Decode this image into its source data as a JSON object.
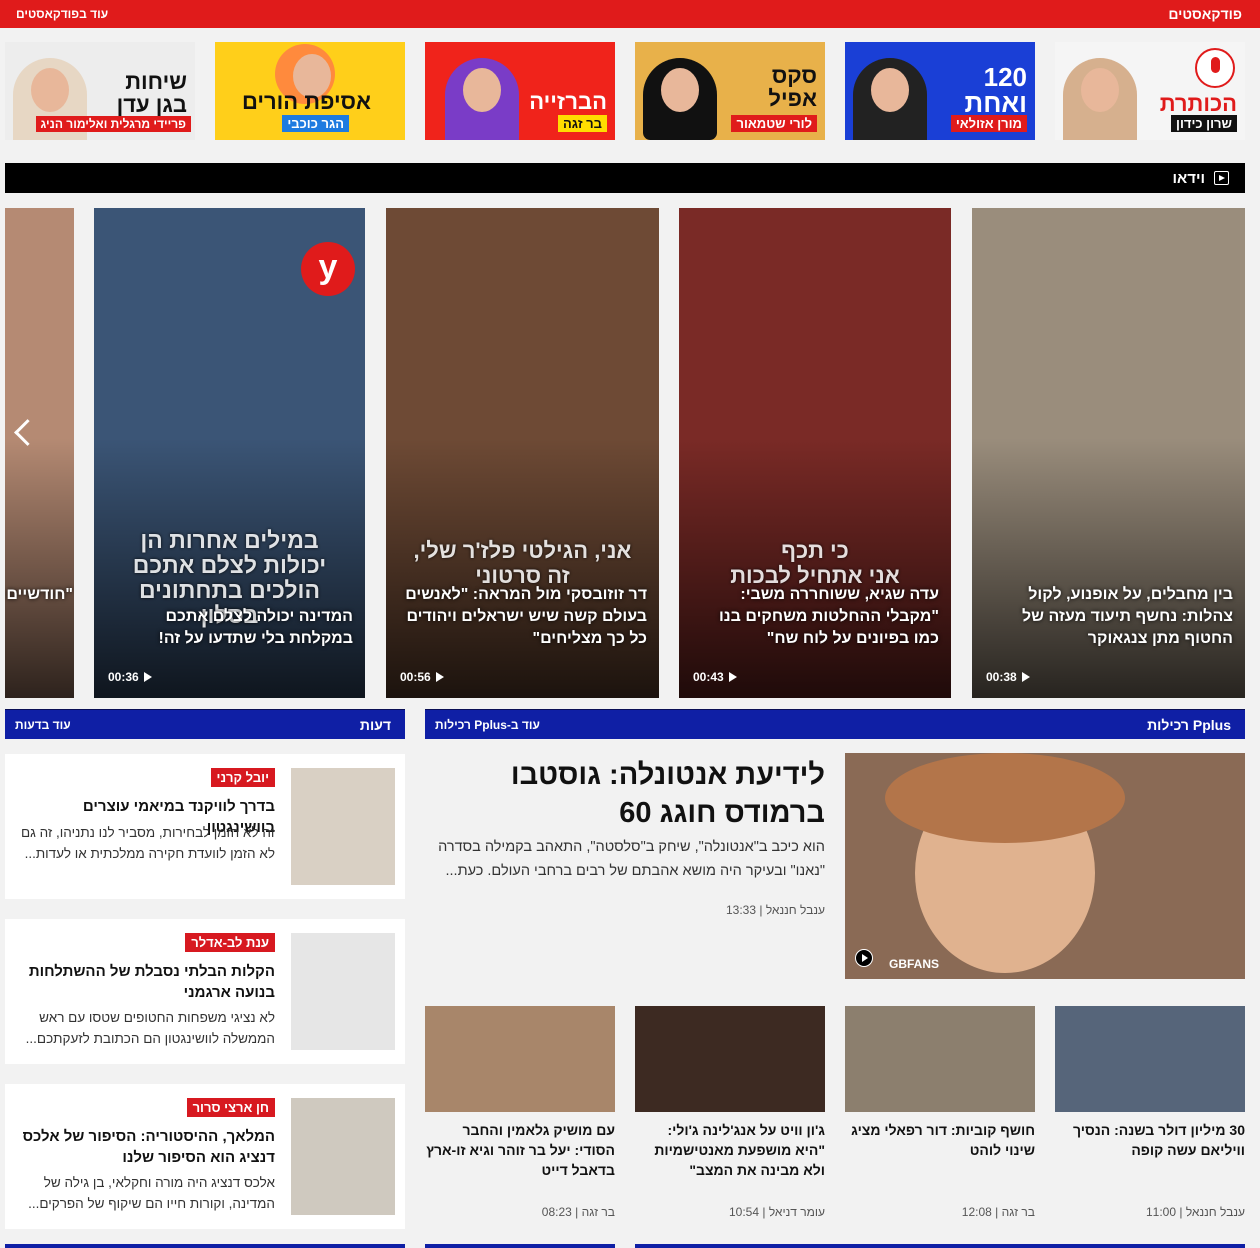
{
  "podcasts": {
    "title": "פודקאסטים",
    "more": "עוד בפודקאסטים",
    "cards": [
      {
        "title": "הכותרת",
        "host": "שרון כידון",
        "bg": "#f5f5f5",
        "title_color": "#e01b1b",
        "host_bg": "#111",
        "host_color": "#fff"
      },
      {
        "title": "120\nואחת",
        "host": "מורן אזולאי",
        "bg": "#1a3fd6",
        "title_color": "#ffffff",
        "host_bg": "#e01b1b",
        "host_color": "#fff"
      },
      {
        "title": "סקס\nאפיל",
        "host": "לורי שטמאור",
        "bg": "#e8b14a",
        "title_color": "#111111",
        "host_bg": "#e01b1b",
        "host_color": "#fff"
      },
      {
        "title": "הברזייה",
        "host": "בר זגה",
        "bg": "#f0231b",
        "title_color": "#ffffff",
        "host_bg": "#ffdd00",
        "host_color": "#111"
      },
      {
        "title": "אסיפת הורים",
        "host": "הגר כוכבי",
        "bg": "#ffcf1a",
        "title_color": "#111111",
        "host_bg": "#1e7be0",
        "host_color": "#fff"
      },
      {
        "title": "שיחות\nבגן עדן",
        "host": "פריידי מרגלית ואלימור הניג",
        "bg": "#ededed",
        "title_color": "#111111",
        "host_bg": "#e01b1b",
        "host_color": "#fff"
      }
    ]
  },
  "video": {
    "title": "וידאו",
    "cards": [
      {
        "overlay": "",
        "caption": "בין מחבלים, על אופנוע, לקול צהלות: נחשף תיעוד מעזה של החטוף מתן צנגאוקר",
        "duration": "00:38",
        "bg": "#9a8d7c"
      },
      {
        "overlay": "כי תכף\nאני אתחיל לבכות",
        "caption": "עדה שגיא, ששוחררה משבי: \"מקבלי ההחלטות משחקים בנו כמו בפיונים על לוח שח\"",
        "duration": "00:43",
        "bg": "#7a2a26"
      },
      {
        "overlay": "אני, הגילטי פלז'ר שלי,\nזה סרטוני",
        "caption": "דר זוזובסקי מול המראה: \"לאנשים בעולם קשה שיש ישראלים ויהודים כל כך מצליחים\"",
        "duration": "00:56",
        "bg": "#6e4a35"
      },
      {
        "overlay": "במילים אחרות הן\nיכולות לצלם אתכם\nהולכים בתחתונים\nבסלון",
        "caption": "המדינה יכולה לצלם אתכם במקלחת בלי שתדעו על זה!",
        "duration": "00:36",
        "bg": "#3b5576",
        "logo": "y"
      },
      {
        "overlay": "",
        "caption": "\"חודשיים שאני ב... צריכה ל...",
        "duration": "",
        "bg": "#b58a73"
      }
    ]
  },
  "opinions": {
    "title": "דעות",
    "more": "עוד בדעות",
    "items": [
      {
        "author": "יובל קרני",
        "title": "בדרך לוויקנד במיאמי עוצרים בוושינגטון",
        "text": "זה לא הזמן לבחירות, מסביר לנו נתניהו, זה גם לא הזמן לוועדת חקירה ממלכתית או לעדות...",
        "photo_bg": "#d9d0c4"
      },
      {
        "author": "ענת לב-אדלר",
        "title": "הקלות הבלתי נסבלת של ההשתלחות בנועה ארגמני",
        "text": "לא נציגי משפחות החטופים שטסו עם ראש הממשלה לוושינגטון הם הכתובת לזעקתכם...",
        "photo_bg": "#e6e6e6"
      },
      {
        "author": "חן ארצי סרור",
        "title": "המלאך, ההיסטוריה: הסיפור של אלכס דנציג הוא הסיפור שלנו",
        "text": "אלכס דנציג היה מורה וחקלאי, בן גילה של המדינה, וקורות חייו הם שיקוף של הפרקים...",
        "photo_bg": "#cfc9bf"
      }
    ]
  },
  "pplus": {
    "title": "Pplus רכילות",
    "more": "עוד ב-Pplus רכילות",
    "main": {
      "title": "לידיעת אנטונלה: גוסטבו ברמודס חוגג 60",
      "text": "הוא כיכב ב\"אנטונלה\", שיחק ב\"סלסטה\", התאהב בקמילה בסדרה \"נאנו\" ובעיקר היה מושא אהבתם של רבים ברחבי העולם. כעת...",
      "author": "ענבל חננאל",
      "time": "13:33",
      "img_label": "GBFANS"
    },
    "cards": [
      {
        "title": "30 מיליון דולר בשנה: הנסיך וויליאם עשה קופה",
        "author": "ענבל חננאל",
        "time": "11:00",
        "bg": "#56657a"
      },
      {
        "title": "חושף קוביות: דור רפאלי מציג שינוי לוהט",
        "author": "בר זגה",
        "time": "12:08",
        "bg": "#8c7f6e"
      },
      {
        "title": "ג'ון וויט על אנג'לינה ג'ולי: \"היא מושפעת מאנטישמיות ולא מבינה את המצב\"",
        "author": "עומר דניאל",
        "time": "10:54",
        "bg": "#3d2a22"
      },
      {
        "title": "עם מושיק גלאמין והחבר הסודי: יעל בר זוהר וגיא זו-ארץ בדאבל דייט",
        "author": "בר זגה",
        "time": "08:23",
        "bg": "#a8866a"
      }
    ]
  }
}
